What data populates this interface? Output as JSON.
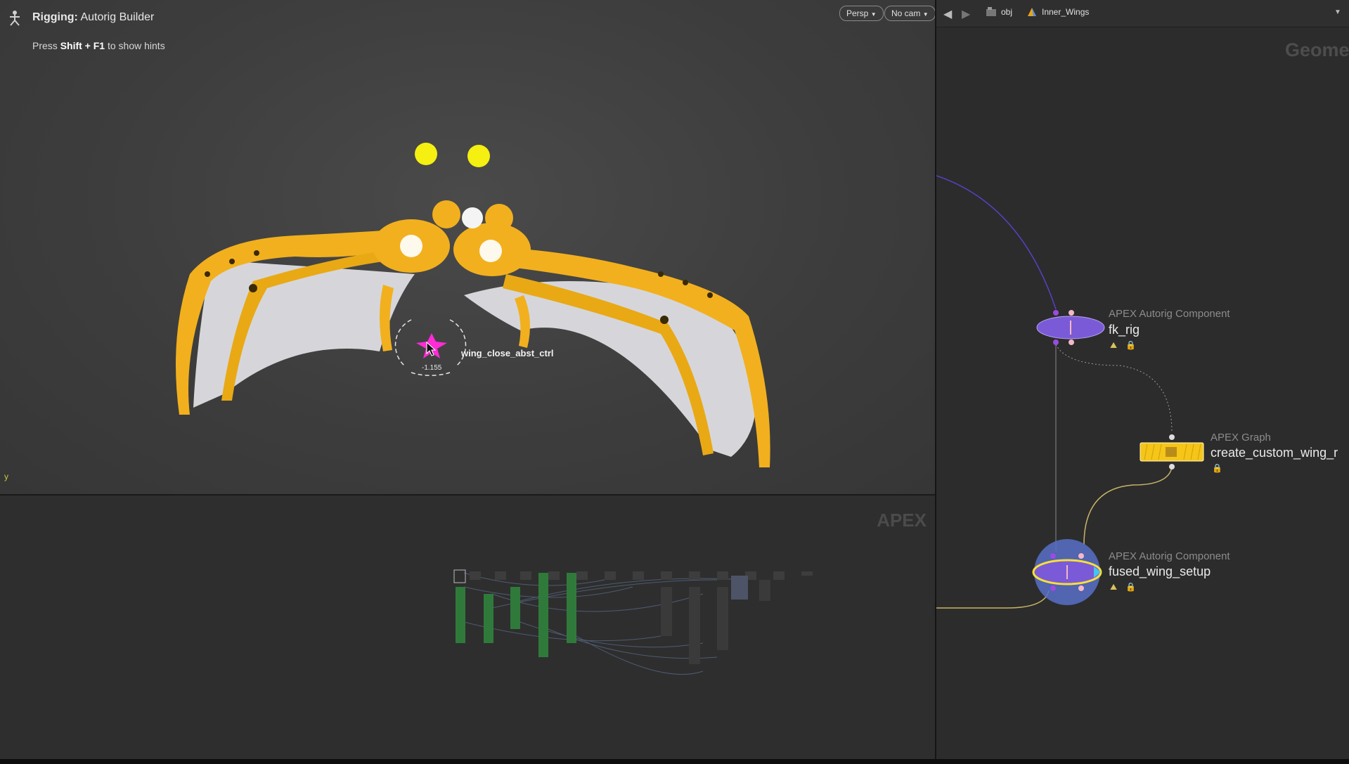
{
  "viewport": {
    "tool_label": "Rigging:",
    "tool_name": "Autorig Builder",
    "hint_prefix": "Press",
    "hint_keys": "Shift + F1",
    "hint_suffix": "to show hints",
    "persp_button": "Persp",
    "cam_button": "No cam",
    "axis_label": "y",
    "control_label": "wing_close_abst_ctrl",
    "control_value": "-1.155"
  },
  "apex_panel": {
    "watermark": "APEX"
  },
  "network": {
    "path": [
      "obj",
      "Inner_Wings"
    ],
    "watermark": "Geome",
    "nodes": [
      {
        "type": "APEX Autorig Component",
        "name": "fk_rig"
      },
      {
        "type": "APEX Graph",
        "name": "create_custom_wing_r"
      },
      {
        "type": "APEX Autorig Component",
        "name": "fused_wing_setup"
      }
    ]
  },
  "colors": {
    "wing_gold": "#f2b01e",
    "membrane": "#d6d6da",
    "control_magenta": "#ff2bd6",
    "node_purple": "#7b5ad8",
    "node_yellow": "#f5c518",
    "wire_blue": "#6a4fd0",
    "wire_yellow": "#c9b467"
  }
}
